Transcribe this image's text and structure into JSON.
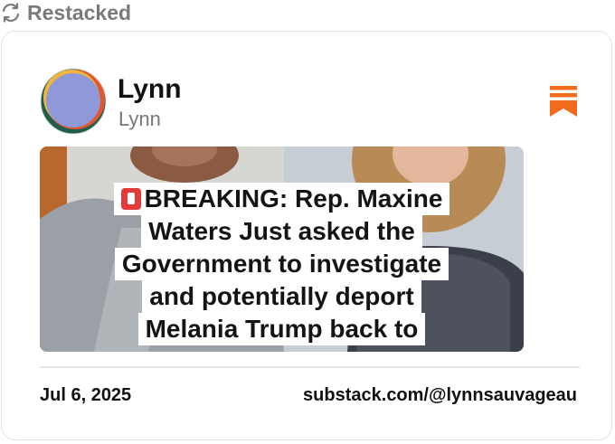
{
  "restack": {
    "label": "Restacked",
    "icon": "refresh-icon"
  },
  "post": {
    "author_name": "Lynn",
    "author_handle": "Lynn",
    "bookmark_icon": "bookmark-icon",
    "accent_color": "#f26b1d",
    "media": {
      "caption_lines": [
        "BREAKING: Rep. Maxine",
        "Waters Just asked the",
        "Government to investigate",
        "and potentially deport",
        "Melania Trump back to"
      ],
      "badge_icon": "alert-badge-icon"
    },
    "date": "Jul 6, 2025",
    "source": "substack.com/@lynnsauvageau"
  }
}
